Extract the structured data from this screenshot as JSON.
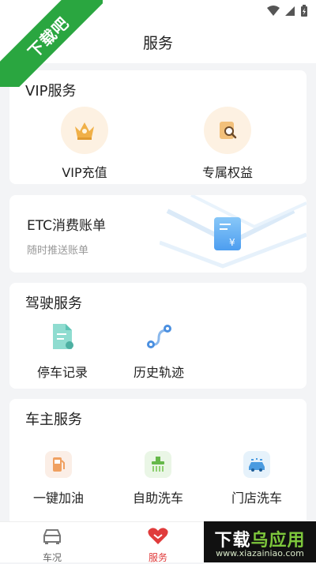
{
  "header": {
    "title": "服务"
  },
  "badge": {
    "text": "下载吧"
  },
  "vip_section": {
    "title": "VIP服务",
    "items": [
      {
        "label": "VIP充值",
        "icon": "crown-icon"
      },
      {
        "label": "专属权益",
        "icon": "benefits-search-icon"
      }
    ]
  },
  "etc": {
    "title": "ETC消费账单",
    "subtitle": "随时推送账单",
    "icon": "bill-yen-icon"
  },
  "drive_section": {
    "title": "驾驶服务",
    "items": [
      {
        "label": "停车记录",
        "icon": "parking-record-icon"
      },
      {
        "label": "历史轨迹",
        "icon": "route-history-icon"
      }
    ]
  },
  "owner_section": {
    "title": "车主服务",
    "items": [
      {
        "label": "一键加油",
        "icon": "fuel-pump-icon"
      },
      {
        "label": "自助洗车",
        "icon": "self-wash-icon"
      },
      {
        "label": "门店洗车",
        "icon": "store-wash-icon"
      }
    ]
  },
  "tabbar": {
    "tabs": [
      {
        "label": "车况",
        "icon": "car-icon",
        "active": false
      },
      {
        "label": "服务",
        "icon": "service-heart-icon",
        "active": true
      }
    ]
  },
  "watermark": {
    "title_white": "下载",
    "title_green": "乌应用",
    "url": "www.xiazainiao.com"
  },
  "colors": {
    "accent": "#e03b3b",
    "badge_green": "#2aa640",
    "card_bg": "#ffffff",
    "page_bg": "#f3f4f6"
  }
}
